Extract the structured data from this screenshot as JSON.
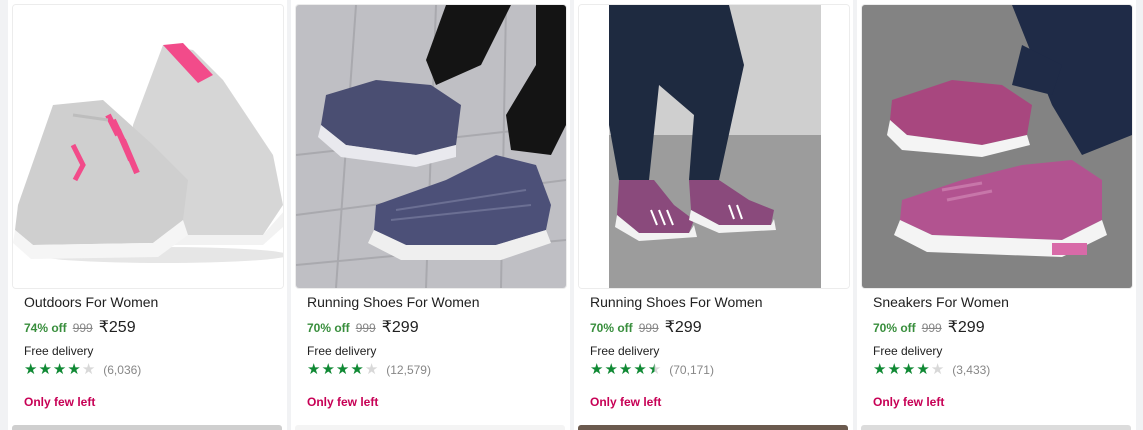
{
  "products": [
    {
      "title": "Outdoors For Women",
      "discount": "74% off",
      "mrp": "999",
      "price": "₹259",
      "delivery": "Free delivery",
      "rating": 4,
      "rating_count": "(6,036)",
      "stock": "Only few left",
      "image": "grey-pink-sneakers"
    },
    {
      "title": "Running Shoes For Women",
      "discount": "70% off",
      "mrp": "999",
      "price": "₹299",
      "delivery": "Free delivery",
      "rating": 4,
      "rating_count": "(12,579)",
      "stock": "Only few left",
      "image": "navy-slip-on-shoes"
    },
    {
      "title": "Running Shoes For Women",
      "discount": "70% off",
      "mrp": "999",
      "price": "₹299",
      "delivery": "Free delivery",
      "rating": 4.5,
      "rating_count": "(70,171)",
      "stock": "Only few left",
      "image": "purple-slip-on-shoes"
    },
    {
      "title": "Sneakers For Women",
      "discount": "70% off",
      "mrp": "999",
      "price": "₹299",
      "delivery": "Free delivery",
      "rating": 4,
      "rating_count": "(3,433)",
      "stock": "Only few left",
      "image": "purple-knit-sneakers"
    }
  ],
  "colors": {
    "discount": "#388e3c",
    "star": "#108934",
    "stock": "#c70055"
  }
}
